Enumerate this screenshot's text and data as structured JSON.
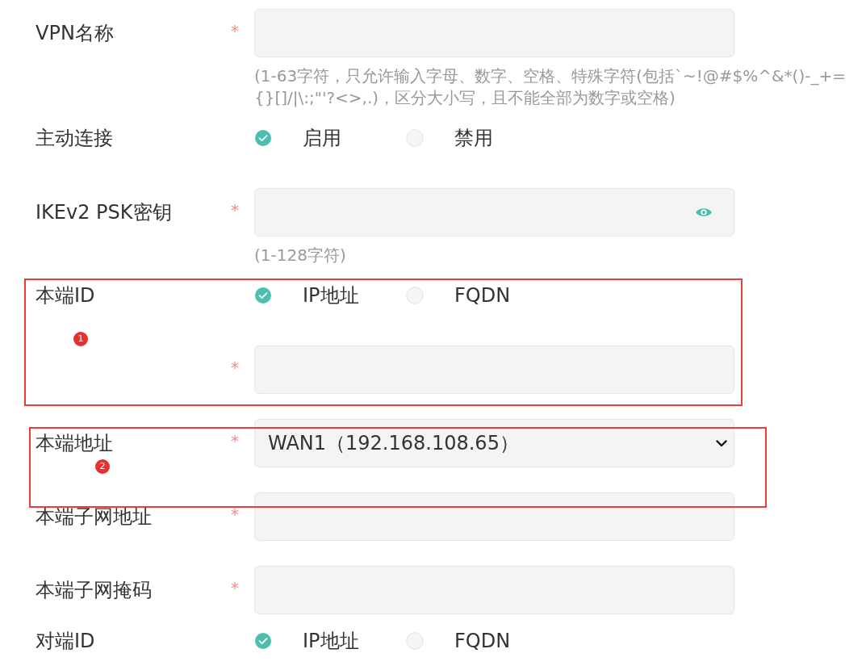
{
  "fields": [
    {
      "kind": "text",
      "label": "VPN名称",
      "required_mark": "*",
      "hint": "(1-63字符，只允许输入字母、数字、空格、特殊字符(包括`~!@#$%^&*()-_+={}[]/|\\:;\"'?<>,.)，区分大小写，且不能全部为数字或空格)"
    },
    {
      "kind": "radio",
      "label": "主动连接",
      "options": [
        {
          "label": "启用",
          "selected": true
        },
        {
          "label": "禁用",
          "selected": false
        }
      ]
    },
    {
      "kind": "password",
      "label": "IKEv2 PSK密钥",
      "required_mark": "*",
      "hint": "(1-128字符)"
    },
    {
      "kind": "callout",
      "label": "1",
      "fields": [
        {
          "kind": "radio",
          "label": "本端ID",
          "options": [
            {
              "label": "IP地址",
              "selected": true
            },
            {
              "label": "FQDN",
              "selected": false
            }
          ]
        },
        {
          "kind": "text",
          "required_mark": "*"
        }
      ]
    },
    {
      "kind": "callout",
      "label": "2",
      "fields": [
        {
          "kind": "select",
          "label": "本端地址",
          "required_mark": "*",
          "value": "WAN1（192.168.108.65）"
        }
      ]
    },
    {
      "kind": "text",
      "label": "本端子网地址",
      "required_mark": "*"
    },
    {
      "kind": "text",
      "label": "本端子网掩码",
      "required_mark": "*"
    },
    {
      "kind": "radio",
      "label": "对端ID",
      "options": [
        {
          "label": "IP地址",
          "selected": true
        },
        {
          "label": "FQDN",
          "selected": false
        }
      ]
    }
  ]
}
